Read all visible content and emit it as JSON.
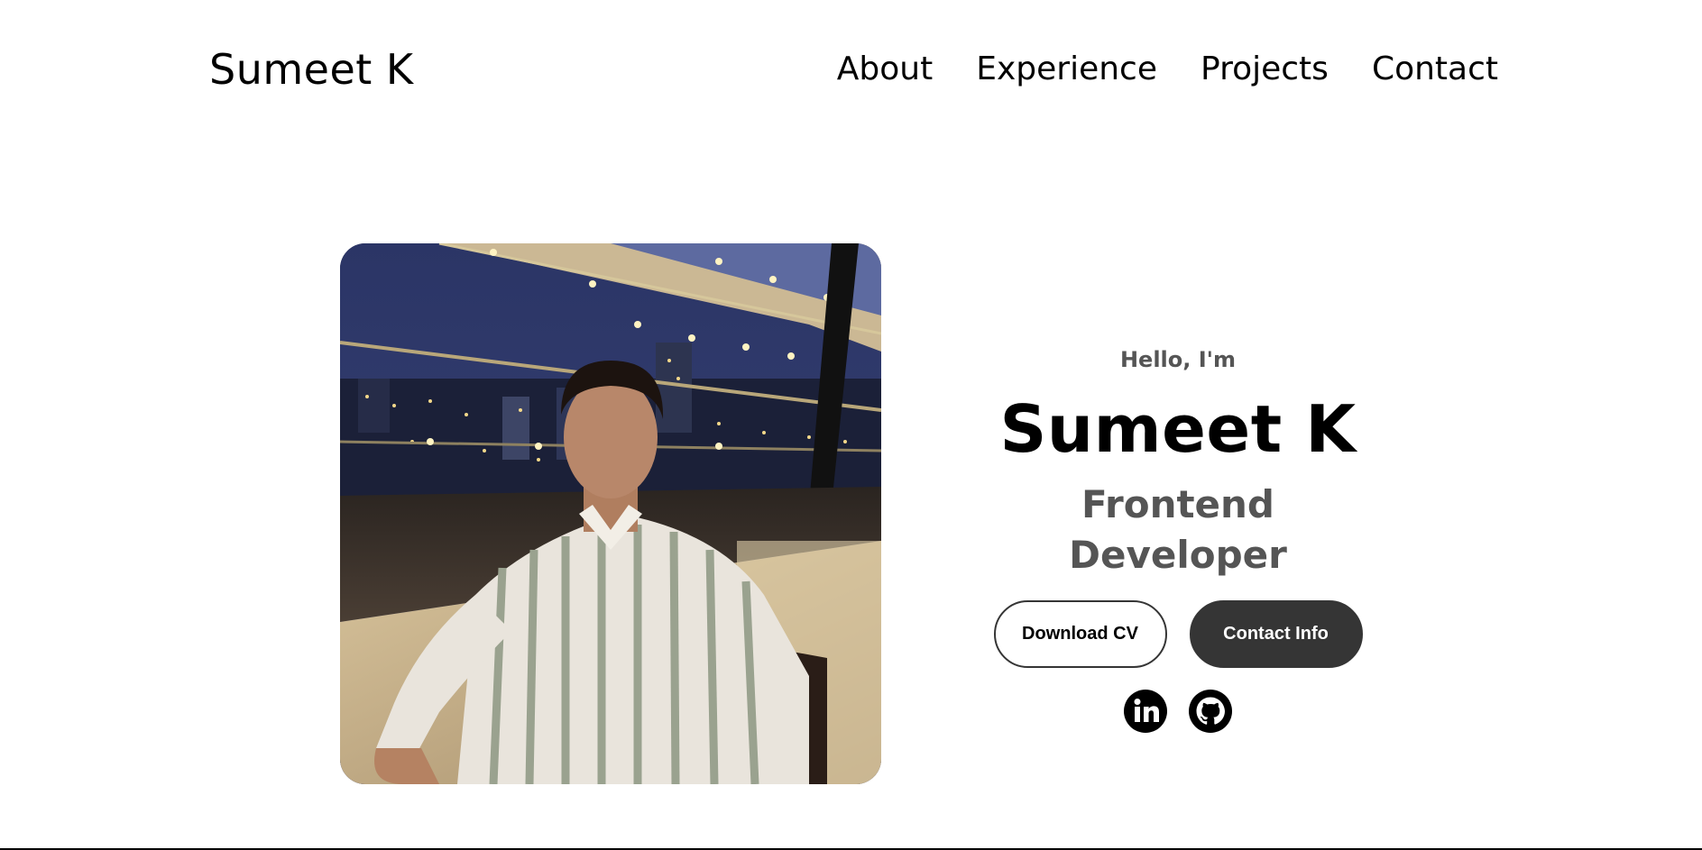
{
  "nav": {
    "logo": "Sumeet K",
    "links": [
      "About",
      "Experience",
      "Projects",
      "Contact"
    ]
  },
  "hero": {
    "greeting": "Hello, I'm",
    "name": "Sumeet K",
    "role": "Frontend Developer",
    "download_cv_label": "Download CV",
    "contact_info_label": "Contact Info"
  },
  "social": {
    "icons": [
      "linkedin-icon",
      "github-icon"
    ]
  },
  "colors": {
    "text": "#000000",
    "muted": "#555555",
    "dark_button": "#353535",
    "background": "#ffffff"
  }
}
